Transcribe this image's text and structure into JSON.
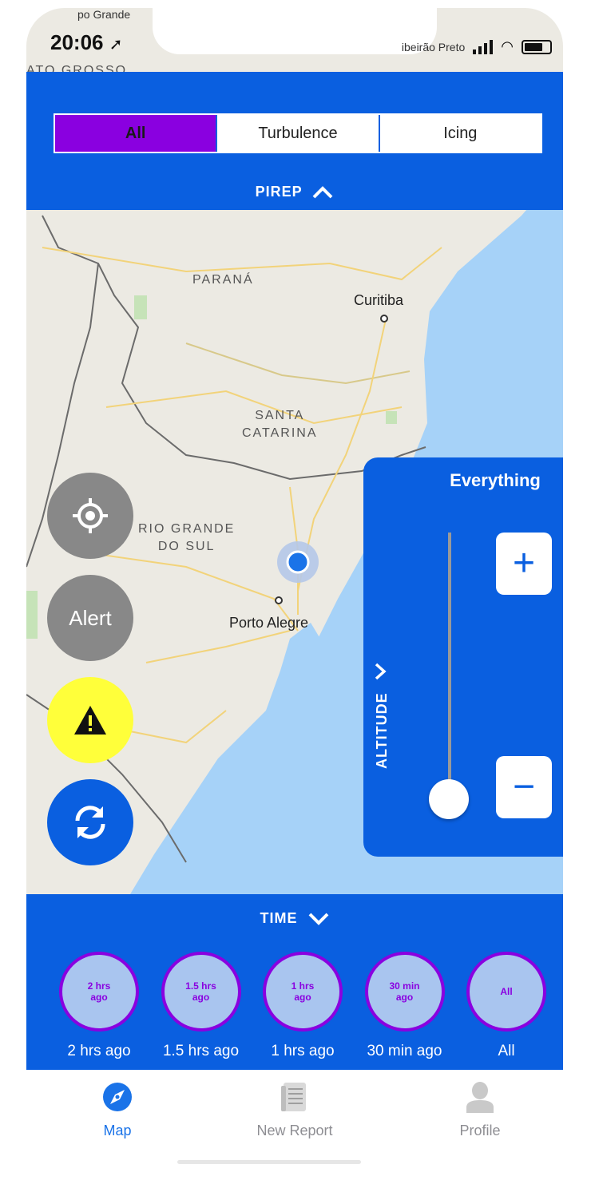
{
  "status_bar": {
    "time": "20:06",
    "top_left_label": "po Grande",
    "top_right_label": "ibeirão Preto"
  },
  "map": {
    "region_labels": [
      "ATO GROSSO",
      "PARANÁ",
      "SANTA\nCATARINA",
      "RIO GRANDE\nDO SUL"
    ],
    "cities": [
      "Curitiba",
      "Porto Alegre"
    ]
  },
  "pirep": {
    "segments": [
      {
        "label": "All",
        "active": true
      },
      {
        "label": "Turbulence",
        "active": false
      },
      {
        "label": "Icing",
        "active": false
      }
    ],
    "toggle_label": "PIREP"
  },
  "fabs": {
    "locate_icon": "crosshair-icon",
    "alert_label": "Alert",
    "warning_icon": "warning-triangle-icon",
    "refresh_icon": "refresh-icon"
  },
  "altitude": {
    "title": "Everything",
    "label": "ALTITUDE",
    "plus": "+",
    "minus": "−",
    "slider_level": 0
  },
  "time": {
    "toggle_label": "TIME",
    "options": [
      {
        "chip": "2 hrs ago",
        "label": "2 hrs ago"
      },
      {
        "chip": "1.5 hrs ago",
        "label": "1.5 hrs ago"
      },
      {
        "chip": "1 hrs ago",
        "label": "1 hrs ago"
      },
      {
        "chip": "30 min ago",
        "label": "30 min ago"
      },
      {
        "chip": "All",
        "label": "All"
      }
    ]
  },
  "tabbar": {
    "tabs": [
      {
        "label": "Map",
        "icon": "compass-icon",
        "active": true
      },
      {
        "label": "New Report",
        "icon": "document-icon",
        "active": false
      },
      {
        "label": "Profile",
        "icon": "person-icon",
        "active": false
      }
    ]
  },
  "colors": {
    "primary_blue": "#0a5fe0",
    "purple": "#8a00e0",
    "yellow": "#ffff3a",
    "gray": "#888888",
    "water": "#a6d2f8"
  }
}
